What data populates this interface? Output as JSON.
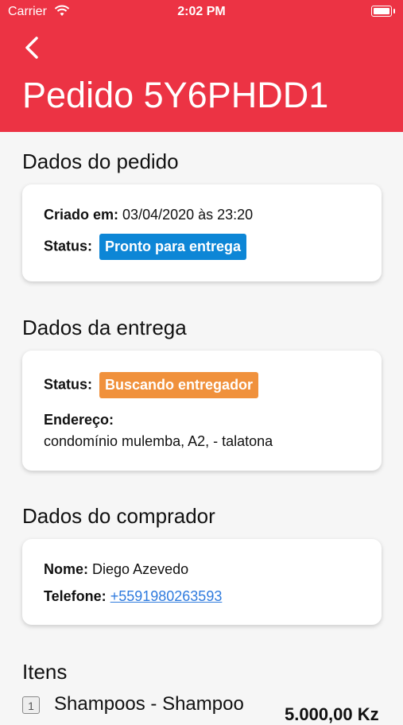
{
  "status_bar": {
    "carrier": "Carrier",
    "time": "2:02 PM"
  },
  "header": {
    "title": "Pedido 5Y6PHDD1",
    "back_icon": "chevron-left-icon"
  },
  "order_section": {
    "title": "Dados do pedido",
    "created_label": "Criado em:",
    "created_value": "03/04/2020 às 23:20",
    "status_label": "Status:",
    "status_value": "Pronto para entrega",
    "status_color": "#0d86d6"
  },
  "delivery_section": {
    "title": "Dados da entrega",
    "status_label": "Status:",
    "status_value": "Buscando entregador",
    "status_color": "#f0913c",
    "address_label": "Endereço:",
    "address_value": "condomínio mulemba, A2,  - talatona"
  },
  "buyer_section": {
    "title": "Dados do comprador",
    "name_label": "Nome:",
    "name_value": "Diego Azevedo",
    "phone_label": "Telefone:",
    "phone_value": "+5591980263593"
  },
  "items_section": {
    "title": "Itens",
    "items": [
      {
        "qty": "1",
        "name": "Shampoos - Shampoo",
        "price": "5.000,00 Kz"
      }
    ]
  },
  "colors": {
    "header": "#ec3344",
    "link": "#2f7bde"
  }
}
